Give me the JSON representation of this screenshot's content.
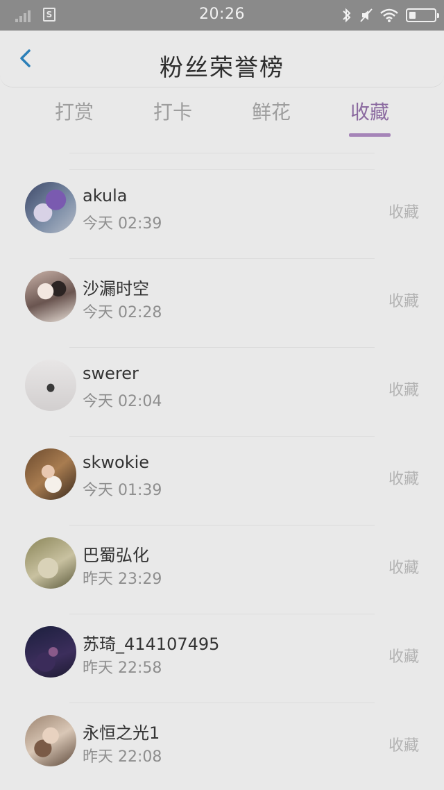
{
  "status_bar": {
    "time": "20:26",
    "sim_label": "S",
    "icons": [
      "signal-icon",
      "sim-icon",
      "bluetooth-icon",
      "mute-icon",
      "wifi-icon",
      "battery-icon"
    ],
    "battery_level": 0.25
  },
  "header": {
    "title": "粉丝荣誉榜",
    "back_icon": "chevron-left-icon"
  },
  "tabs": [
    {
      "label": "打赏",
      "active": false
    },
    {
      "label": "打卡",
      "active": false
    },
    {
      "label": "鲜花",
      "active": false
    },
    {
      "label": "收藏",
      "active": true
    }
  ],
  "list": [
    {
      "name": "akula",
      "time": "今天 02:39",
      "action": "收藏"
    },
    {
      "name": "沙漏时空",
      "time": "今天 02:28",
      "action": "收藏"
    },
    {
      "name": "swerer",
      "time": "今天 02:04",
      "action": "收藏"
    },
    {
      "name": "skwokie",
      "time": "今天 01:39",
      "action": "收藏"
    },
    {
      "name": "巴蜀弘化",
      "time": "昨天 23:29",
      "action": "收藏"
    },
    {
      "name": "苏琦_414107495",
      "time": "昨天 22:58",
      "action": "收藏"
    },
    {
      "name": "永恒之光1",
      "time": "昨天 22:08",
      "action": "收藏"
    }
  ],
  "colors": {
    "accent": "#8b6aa0",
    "back_arrow": "#2b7fb8",
    "overlay_background": "#e9e9e9"
  }
}
